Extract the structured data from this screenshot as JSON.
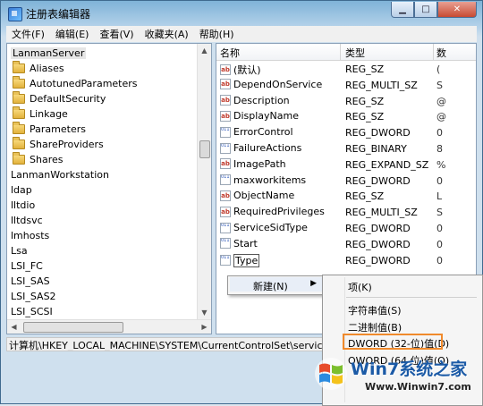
{
  "window": {
    "title": "注册表编辑器"
  },
  "menu": [
    "文件(F)",
    "编辑(E)",
    "查看(V)",
    "收藏夹(A)",
    "帮助(H)"
  ],
  "tree": {
    "items": [
      {
        "label": "LanmanServer",
        "folder": false,
        "selected": true
      },
      {
        "label": "Aliases",
        "folder": true
      },
      {
        "label": "AutotunedParameters",
        "folder": true
      },
      {
        "label": "DefaultSecurity",
        "folder": true
      },
      {
        "label": "Linkage",
        "folder": true
      },
      {
        "label": "Parameters",
        "folder": true
      },
      {
        "label": "ShareProviders",
        "folder": true
      },
      {
        "label": "Shares",
        "folder": true
      },
      {
        "label": "LanmanWorkstation",
        "folder": false
      },
      {
        "label": "ldap",
        "folder": false
      },
      {
        "label": "lltdio",
        "folder": false
      },
      {
        "label": "lltdsvc",
        "folder": false
      },
      {
        "label": "lmhosts",
        "folder": false
      },
      {
        "label": "Lsa",
        "folder": false
      },
      {
        "label": "LSI_FC",
        "folder": false
      },
      {
        "label": "LSI_SAS",
        "folder": false
      },
      {
        "label": "LSI_SAS2",
        "folder": false
      },
      {
        "label": "LSI_SCSI",
        "folder": false
      }
    ]
  },
  "values": {
    "headers": {
      "name": "名称",
      "type": "类型",
      "data": "数"
    },
    "rows": [
      {
        "name": "(默认)",
        "type": "REG_SZ",
        "data": "(",
        "icon": "ab"
      },
      {
        "name": "DependOnService",
        "type": "REG_MULTI_SZ",
        "data": "S",
        "icon": "ab"
      },
      {
        "name": "Description",
        "type": "REG_SZ",
        "data": "@",
        "icon": "ab"
      },
      {
        "name": "DisplayName",
        "type": "REG_SZ",
        "data": "@",
        "icon": "ab"
      },
      {
        "name": "ErrorControl",
        "type": "REG_DWORD",
        "data": "0",
        "icon": "bin"
      },
      {
        "name": "FailureActions",
        "type": "REG_BINARY",
        "data": "8",
        "icon": "bin"
      },
      {
        "name": "ImagePath",
        "type": "REG_EXPAND_SZ",
        "data": "%",
        "icon": "ab"
      },
      {
        "name": "maxworkitems",
        "type": "REG_DWORD",
        "data": "0",
        "icon": "bin"
      },
      {
        "name": "ObjectName",
        "type": "REG_SZ",
        "data": "L",
        "icon": "ab"
      },
      {
        "name": "RequiredPrivileges",
        "type": "REG_MULTI_SZ",
        "data": "S",
        "icon": "ab"
      },
      {
        "name": "ServiceSidType",
        "type": "REG_DWORD",
        "data": "0",
        "icon": "bin"
      },
      {
        "name": "Start",
        "type": "REG_DWORD",
        "data": "0",
        "icon": "bin"
      },
      {
        "name": "Type",
        "type": "REG_DWORD",
        "data": "0",
        "icon": "bin"
      }
    ]
  },
  "status_path": "计算机\\HKEY_LOCAL_MACHINE\\SYSTEM\\CurrentControlSet\\services\\La",
  "context_menu": {
    "new_label": "新建(N)",
    "arrow": "▶"
  },
  "submenu": {
    "key": "项(K)",
    "string": "字符串值(S)",
    "binary": "二进制值(B)",
    "dword": "DWORD (32-位)值(D)",
    "qword": "QWORD (64 位)值(Q)"
  },
  "watermark": {
    "brand": "Win7系统之家",
    "url": "Www.Winwin7.com"
  },
  "colors": {
    "highlight": "#f08a2c",
    "brand": "#1b5aa6"
  }
}
